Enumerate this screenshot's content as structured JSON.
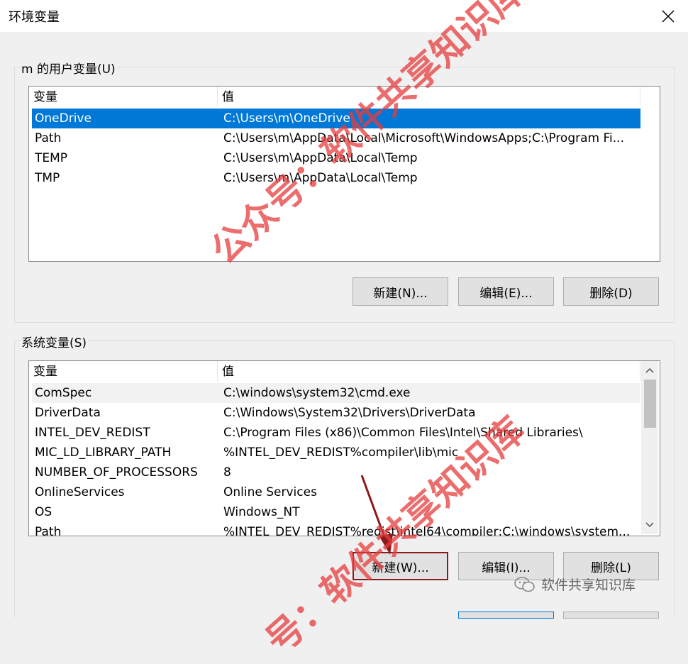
{
  "window": {
    "title": "环境变量"
  },
  "user_vars": {
    "group_label": "m 的用户变量(U)",
    "columns": [
      "变量",
      "值"
    ],
    "rows": [
      {
        "name": "OneDrive",
        "value": "C:\\Users\\m\\OneDrive"
      },
      {
        "name": "Path",
        "value": "C:\\Users\\m\\AppData\\Local\\Microsoft\\WindowsApps;C:\\Program Fi..."
      },
      {
        "name": "TEMP",
        "value": "C:\\Users\\m\\AppData\\Local\\Temp"
      },
      {
        "name": "TMP",
        "value": "C:\\Users\\m\\AppData\\Local\\Temp"
      }
    ],
    "buttons": {
      "new": "新建(N)...",
      "edit": "编辑(E)...",
      "delete": "删除(D)"
    }
  },
  "system_vars": {
    "group_label": "系统变量(S)",
    "columns": [
      "变量",
      "值"
    ],
    "rows": [
      {
        "name": "ComSpec",
        "value": "C:\\windows\\system32\\cmd.exe"
      },
      {
        "name": "DriverData",
        "value": "C:\\Windows\\System32\\Drivers\\DriverData"
      },
      {
        "name": "INTEL_DEV_REDIST",
        "value": "C:\\Program Files (x86)\\Common Files\\Intel\\Shared Libraries\\"
      },
      {
        "name": "MIC_LD_LIBRARY_PATH",
        "value": "%INTEL_DEV_REDIST%compiler\\lib\\mic"
      },
      {
        "name": "NUMBER_OF_PROCESSORS",
        "value": "8"
      },
      {
        "name": "OnlineServices",
        "value": "Online Services"
      },
      {
        "name": "OS",
        "value": "Windows_NT"
      },
      {
        "name": "Path",
        "value": "%INTEL_DEV_REDIST%redist\\intel64\\compiler;C:\\windows\\system..."
      }
    ],
    "buttons": {
      "new": "新建(W)...",
      "edit": "编辑(I)...",
      "delete": "删除(L)"
    }
  },
  "watermark": {
    "text1": "公众号：软件共享知识库",
    "text2": "号：软件共享知识库"
  },
  "brand": {
    "text": "软件共享知识库"
  },
  "colors": {
    "selection": "#0078d7",
    "watermark": "#e63c3c",
    "highlight_border": "#8b1a1a"
  }
}
